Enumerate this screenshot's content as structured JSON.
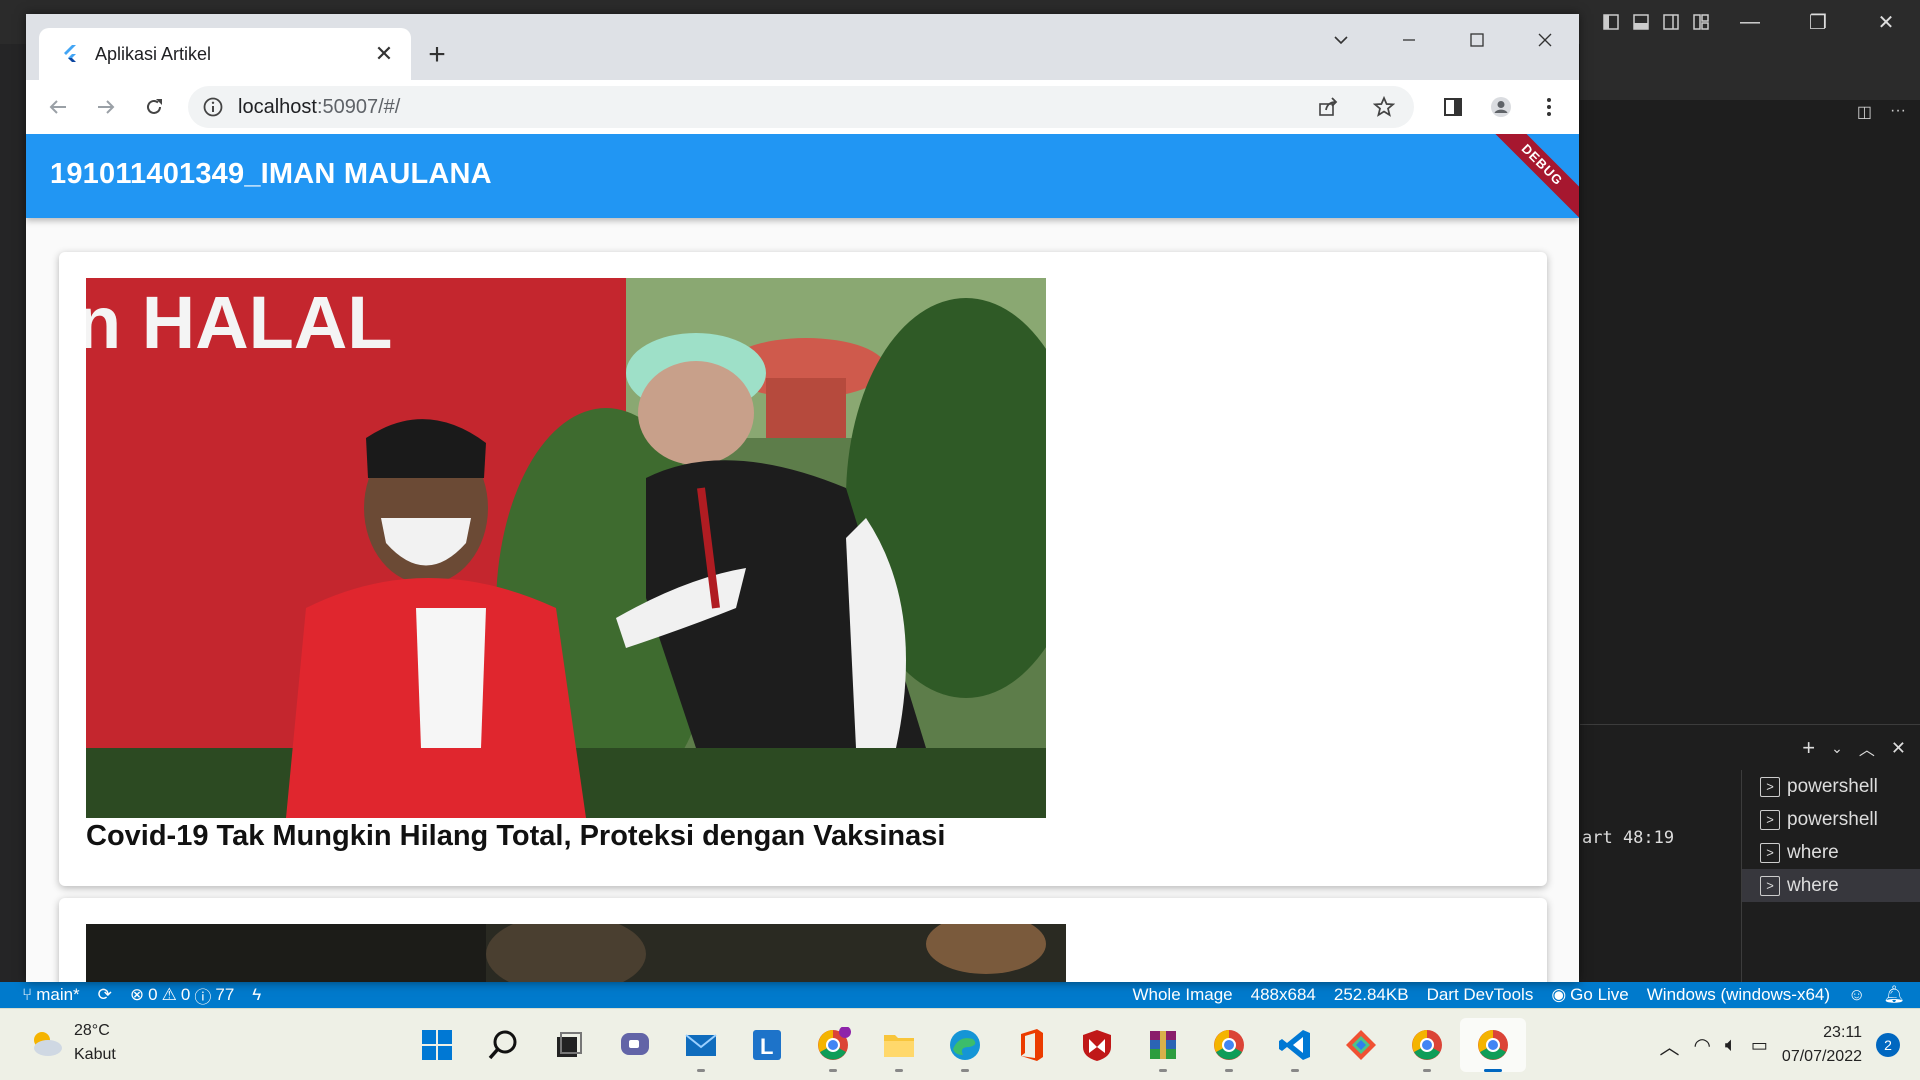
{
  "browser": {
    "tab_title": "Aplikasi Artikel",
    "url_host": "localhost",
    "url_rest": ":50907/#/"
  },
  "app": {
    "appbar_title": "191011401349_IMAN MAULANA",
    "debug_banner": "DEBUG",
    "articles": [
      {
        "title": "Covid-19 Tak Mungkin Hilang Total, Proteksi dengan Vaksinasi",
        "image_text": "n HALAL"
      },
      {
        "title": ""
      }
    ]
  },
  "vscode": {
    "terminal_line": "art 48:19",
    "terminal_list": [
      "powershell",
      "powershell",
      "where",
      "where"
    ],
    "status": {
      "branch": "main*",
      "errors": "0",
      "warnings": "0",
      "infos": "77",
      "whole_image": "Whole Image",
      "dimensions": "488x684",
      "size": "252.84KB",
      "devtools": "Dart DevTools",
      "golive": "Go Live",
      "device": "Windows (windows-x64)"
    }
  },
  "taskbar": {
    "temperature": "28°C",
    "weather": "Kabut",
    "time": "23:11",
    "date": "07/07/2022",
    "notifications": "2"
  },
  "colors": {
    "appbar": "#2196f3",
    "statusbar": "#007acc",
    "debug": "#a6172f"
  }
}
